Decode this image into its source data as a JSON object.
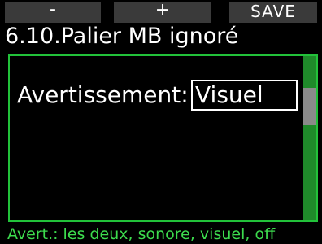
{
  "softkeys": {
    "minus_label": "-",
    "plus_label": "+",
    "save_label": "SAVE"
  },
  "screen": {
    "title": "6.10.Palier MB ignoré"
  },
  "setting": {
    "label": "Avertissement:",
    "value": "Visuel"
  },
  "scrollbar": {
    "position_fraction": 0.25
  },
  "footer": {
    "hint": "Avert.: les deux, sonore, visuel, off"
  },
  "colors": {
    "accent_green": "#22c23a",
    "hint_green": "#3ddc4e",
    "softkey_bg": "#3a3a3a",
    "background": "#000000",
    "text": "#ffffff"
  }
}
